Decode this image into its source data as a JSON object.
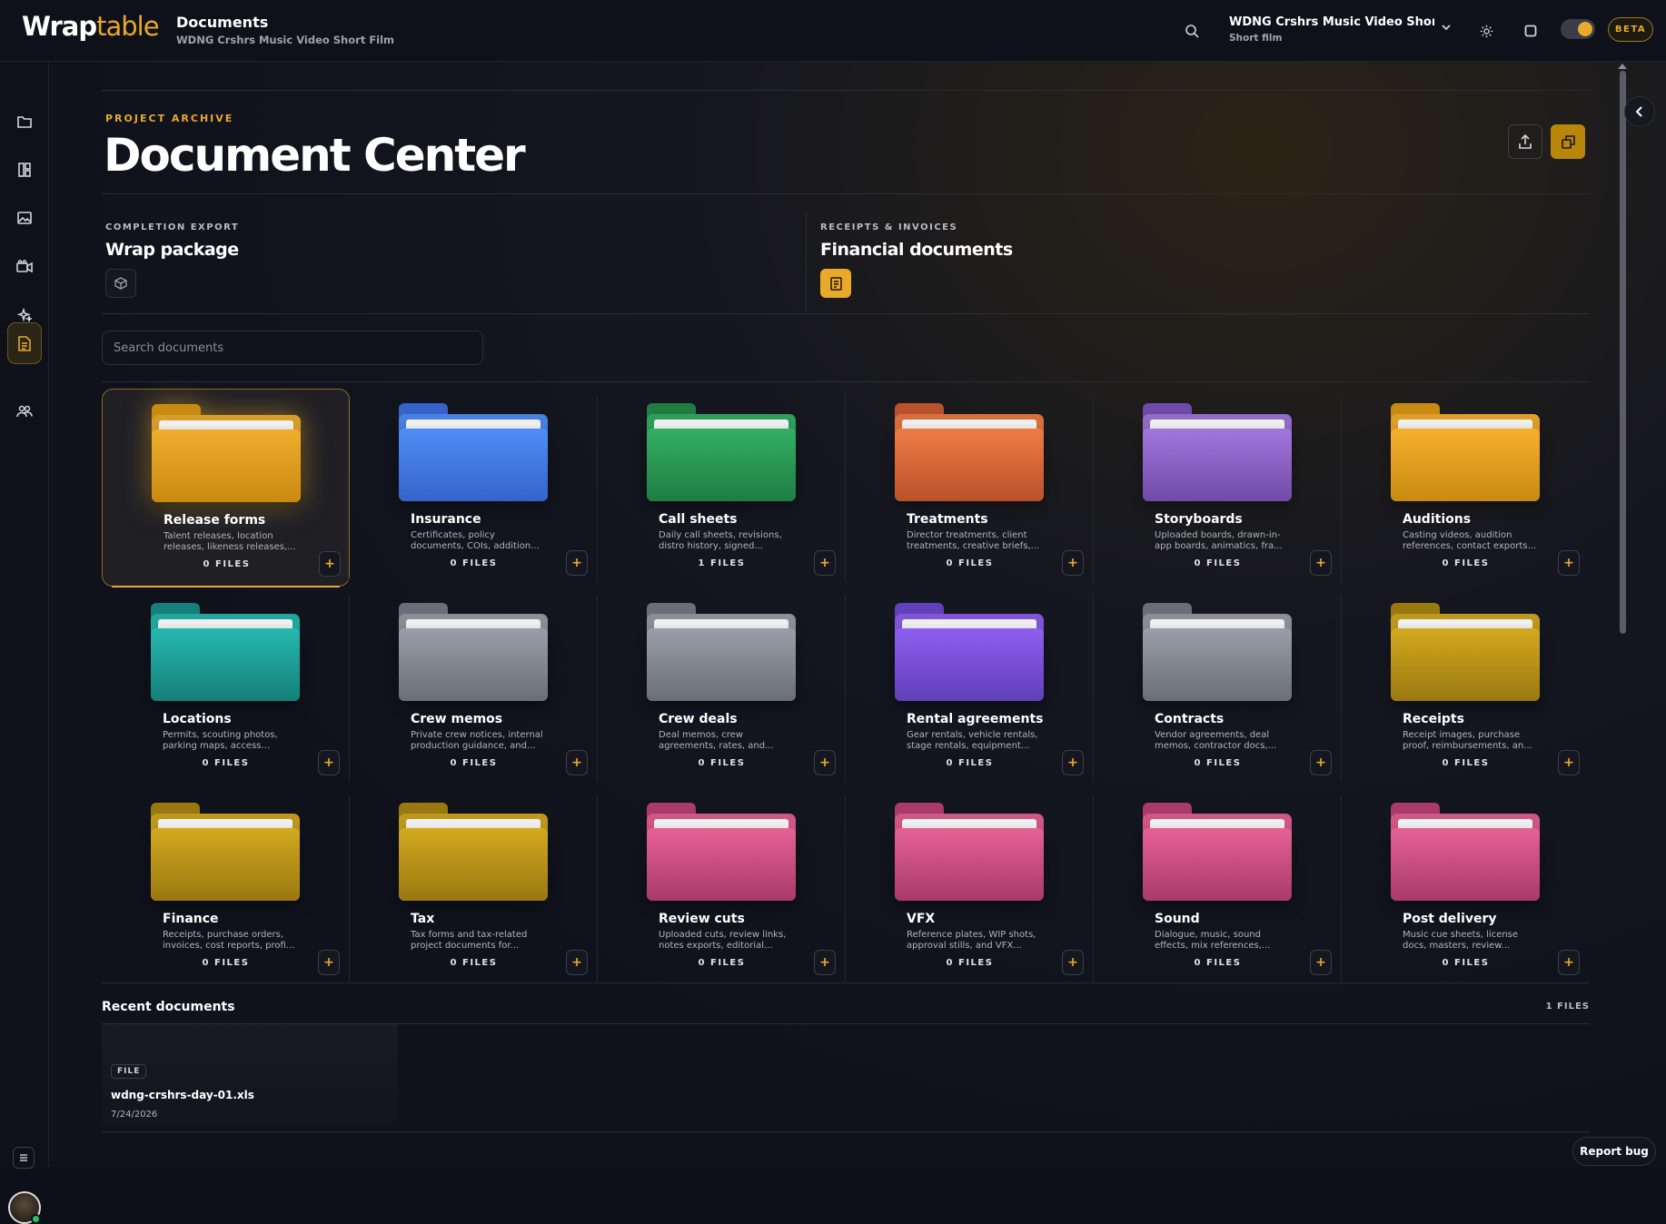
{
  "app": {
    "logo_a": "Wrap",
    "logo_b": "table"
  },
  "breadcrumb": {
    "title": "Documents",
    "subtitle": "WDNG Crshrs Music Video Short Film"
  },
  "project": {
    "name": "WDNG Crshrs Music Video Short Fi...",
    "type": "Short film"
  },
  "beta": "BETA",
  "header": {
    "eyebrow": "PROJECT ARCHIVE",
    "title": "Document Center"
  },
  "sections": [
    {
      "eyebrow": "COMPLETION EXPORT",
      "title": "Wrap package",
      "icon": "box-icon"
    },
    {
      "eyebrow": "RECEIPTS & INVOICES",
      "title": "Financial documents",
      "icon": "document-icon"
    }
  ],
  "search": {
    "placeholder": "Search documents"
  },
  "folders": [
    {
      "title": "Release forms",
      "desc": "Talent releases, location releases, likeness releases,...",
      "count": "0 FILES",
      "color": "#f0ad2e",
      "tab": "#c98a10"
    },
    {
      "title": "Insurance",
      "desc": "Certificates, policy documents, COIs, addition...",
      "count": "0 FILES",
      "color": "#4f8ef7",
      "tab": "#3563c9"
    },
    {
      "title": "Call sheets",
      "desc": "Daily call sheets, revisions, distro history, signed...",
      "count": "1 FILES",
      "color": "#33b064",
      "tab": "#1f7d42"
    },
    {
      "title": "Treatments",
      "desc": "Director treatments, client treatments, creative briefs,...",
      "count": "0 FILES",
      "color": "#ee7b45",
      "tab": "#b9522a"
    },
    {
      "title": "Storyboards",
      "desc": "Uploaded boards, drawn-in-app boards, animatics, fra...",
      "count": "0 FILES",
      "color": "#a277dc",
      "tab": "#6f4aa8"
    },
    {
      "title": "Auditions",
      "desc": "Casting videos, audition references, contact exports...",
      "count": "0 FILES",
      "color": "#f6b02c",
      "tab": "#c88a12"
    },
    {
      "title": "Locations",
      "desc": "Permits, scouting photos, parking maps, access...",
      "count": "0 FILES",
      "color": "#25b8b0",
      "tab": "#158079"
    },
    {
      "title": "Crew memos",
      "desc": "Private crew notices, internal production guidance, and...",
      "count": "0 FILES",
      "color": "#9a9ea8",
      "tab": "#6a6e78"
    },
    {
      "title": "Crew deals",
      "desc": "Deal memos, crew agreements, rates, and...",
      "count": "0 FILES",
      "color": "#9a9ea8",
      "tab": "#6a6e78"
    },
    {
      "title": "Rental agreements",
      "desc": "Gear rentals, vehicle rentals, stage rentals, equipment...",
      "count": "0 FILES",
      "color": "#8f5ef0",
      "tab": "#6140b8"
    },
    {
      "title": "Contracts",
      "desc": "Vendor agreements, deal memos, contractor docs,...",
      "count": "0 FILES",
      "color": "#9a9ea8",
      "tab": "#6a6e78"
    },
    {
      "title": "Receipts",
      "desc": "Receipt images, purchase proof, reimbursements, an...",
      "count": "0 FILES",
      "color": "#d3a91f",
      "tab": "#9a7810"
    },
    {
      "title": "Finance",
      "desc": "Receipts, purchase orders, invoices, cost reports, profi...",
      "count": "0 FILES",
      "color": "#d3a91f",
      "tab": "#9a7810"
    },
    {
      "title": "Tax",
      "desc": "Tax forms and tax-related project documents for...",
      "count": "0 FILES",
      "color": "#d3a91f",
      "tab": "#9a7810"
    },
    {
      "title": "Review cuts",
      "desc": "Uploaded cuts, review links, notes exports, editorial...",
      "count": "0 FILES",
      "color": "#e66193",
      "tab": "#a83b67"
    },
    {
      "title": "VFX",
      "desc": "Reference plates, WIP shots, approval stills, and VFX...",
      "count": "0 FILES",
      "color": "#e66193",
      "tab": "#a83b67"
    },
    {
      "title": "Sound",
      "desc": "Dialogue, music, sound effects, mix references,...",
      "count": "0 FILES",
      "color": "#e66193",
      "tab": "#a83b67"
    },
    {
      "title": "Post delivery",
      "desc": "Music cue sheets, license docs, masters, review...",
      "count": "0 FILES",
      "color": "#e66193",
      "tab": "#a83b67"
    }
  ],
  "recent": {
    "title": "Recent documents",
    "count": "1 FILES",
    "items": [
      {
        "badge": "FILE",
        "name": "wdng-crshrs-day-01.xls",
        "date": "7/24/2026"
      }
    ]
  },
  "report_bug": "Report bug",
  "colors": {
    "accent": "#e9a92a",
    "background": "#0d1019"
  }
}
